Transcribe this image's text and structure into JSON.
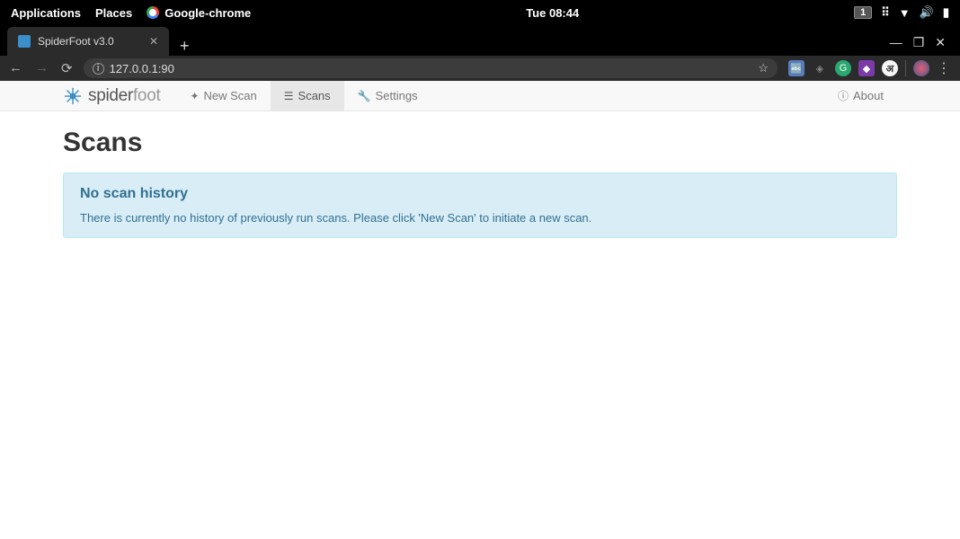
{
  "os": {
    "menus": {
      "applications": "Applications",
      "places": "Places",
      "chrome": "Google-chrome"
    },
    "clock": "Tue 08:44",
    "workspace": "1"
  },
  "browser": {
    "tab_title": "SpiderFoot v3.0",
    "url": "127.0.0.1:90"
  },
  "app": {
    "brand_strong": "spider",
    "brand_light": "foot",
    "nav": {
      "new_scan": "New Scan",
      "scans": "Scans",
      "settings": "Settings",
      "about": "About"
    }
  },
  "page": {
    "heading": "Scans",
    "alert_title": "No scan history",
    "alert_text": "There is currently no history of previously run scans. Please click 'New Scan' to initiate a new scan."
  }
}
